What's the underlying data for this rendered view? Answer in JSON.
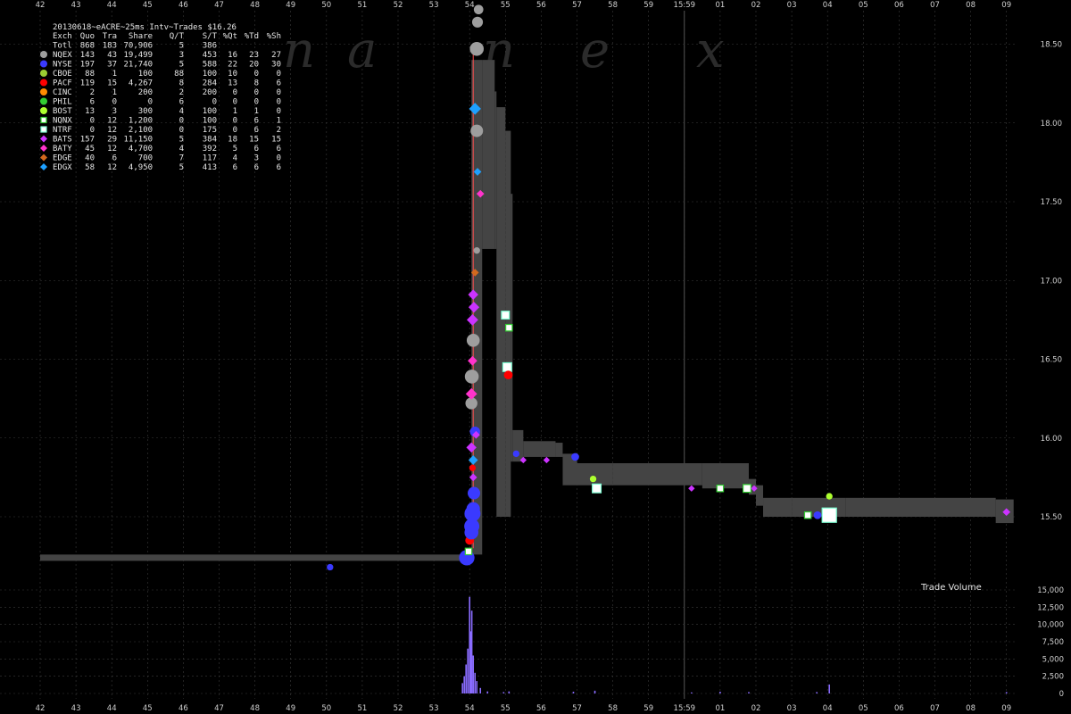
{
  "chart_data": {
    "type": "scatter",
    "title": "20130618~eACRE~25ms Intv~Trades $16.26",
    "watermark": [
      "n",
      "a",
      "n",
      "e",
      "x"
    ],
    "grid": true,
    "colors": {
      "background": "#000000",
      "grid": "#3a3a3a",
      "nbbo_band": "#444444",
      "text": "#e6e6e6"
    },
    "x_axis": {
      "tick_labels": [
        "42",
        "43",
        "44",
        "45",
        "46",
        "47",
        "48",
        "49",
        "50",
        "51",
        "52",
        "53",
        "54",
        "55",
        "56",
        "57",
        "58",
        "59",
        "15:59",
        "01",
        "02",
        "03",
        "04",
        "05",
        "06",
        "07",
        "08",
        "09"
      ]
    },
    "price_axis": {
      "ylim": [
        15.1,
        18.7
      ],
      "ticks": [
        15.5,
        16.0,
        16.5,
        17.0,
        17.5,
        18.0,
        18.5
      ],
      "tick_labels": [
        "15.50",
        "16.00",
        "16.50",
        "17.00",
        "17.50",
        "18.00",
        "18.50"
      ]
    },
    "volume_axis": {
      "title": "Trade Volume",
      "ylim": [
        0,
        15000
      ],
      "ticks": [
        0,
        2500,
        5000,
        7500,
        10000,
        12500,
        15000
      ],
      "tick_labels": [
        "0",
        "2,500",
        "5,000",
        "7,500",
        "10,000",
        "12,500",
        "15,000"
      ]
    },
    "legend": {
      "header": [
        "Exch",
        "Quo",
        "Tra",
        "Share",
        "Q/T",
        "S/T",
        "%Qt",
        "%Td",
        "%Sh"
      ],
      "rows": [
        {
          "exch": "Totl",
          "quo": "868",
          "tra": "183",
          "share": "70,906",
          "qt": "5",
          "st": "386",
          "pqt": "",
          "ptd": "",
          "psh": "",
          "color": "",
          "marker": "none"
        },
        {
          "exch": "NQEX",
          "quo": "143",
          "tra": "43",
          "share": "19,499",
          "qt": "3",
          "st": "453",
          "pqt": "16",
          "ptd": "23",
          "psh": "27",
          "color": "#9e9e9e",
          "marker": "circle"
        },
        {
          "exch": "NYSE",
          "quo": "197",
          "tra": "37",
          "share": "21,740",
          "qt": "5",
          "st": "588",
          "pqt": "22",
          "ptd": "20",
          "psh": "30",
          "color": "#3a3aff",
          "marker": "circle"
        },
        {
          "exch": "CBOE",
          "quo": "88",
          "tra": "1",
          "share": "100",
          "qt": "88",
          "st": "100",
          "pqt": "10",
          "ptd": "0",
          "psh": "0",
          "color": "#9acd32",
          "marker": "circle"
        },
        {
          "exch": "PACF",
          "quo": "119",
          "tra": "15",
          "share": "4,267",
          "qt": "8",
          "st": "284",
          "pqt": "13",
          "ptd": "8",
          "psh": "6",
          "color": "#ff0000",
          "marker": "circle"
        },
        {
          "exch": "CINC",
          "quo": "2",
          "tra": "1",
          "share": "200",
          "qt": "2",
          "st": "200",
          "pqt": "0",
          "ptd": "0",
          "psh": "0",
          "color": "#ff8c00",
          "marker": "circle"
        },
        {
          "exch": "PHIL",
          "quo": "6",
          "tra": "0",
          "share": "0",
          "qt": "6",
          "st": "0",
          "pqt": "0",
          "ptd": "0",
          "psh": "0",
          "color": "#32cd32",
          "marker": "circle"
        },
        {
          "exch": "BOST",
          "quo": "13",
          "tra": "3",
          "share": "300",
          "qt": "4",
          "st": "100",
          "pqt": "1",
          "ptd": "1",
          "psh": "0",
          "color": "#adff2f",
          "marker": "circle"
        },
        {
          "exch": "NQNX",
          "quo": "0",
          "tra": "12",
          "share": "1,200",
          "qt": "0",
          "st": "100",
          "pqt": "0",
          "ptd": "6",
          "psh": "1",
          "color": "#32cd32",
          "marker": "square"
        },
        {
          "exch": "NTRF",
          "quo": "0",
          "tra": "12",
          "share": "2,100",
          "qt": "0",
          "st": "175",
          "pqt": "0",
          "ptd": "6",
          "psh": "2",
          "color": "#7fffd4",
          "marker": "square"
        },
        {
          "exch": "BATS",
          "quo": "157",
          "tra": "29",
          "share": "11,150",
          "qt": "5",
          "st": "384",
          "pqt": "18",
          "ptd": "15",
          "psh": "15",
          "color": "#cc33ff",
          "marker": "diamond"
        },
        {
          "exch": "BATY",
          "quo": "45",
          "tra": "12",
          "share": "4,700",
          "qt": "4",
          "st": "392",
          "pqt": "5",
          "ptd": "6",
          "psh": "6",
          "color": "#ff33cc",
          "marker": "diamond"
        },
        {
          "exch": "EDGE",
          "quo": "40",
          "tra": "6",
          "share": "700",
          "qt": "7",
          "st": "117",
          "pqt": "4",
          "ptd": "3",
          "psh": "0",
          "color": "#d2691e",
          "marker": "diamond"
        },
        {
          "exch": "EDGX",
          "quo": "58",
          "tra": "12",
          "share": "4,950",
          "qt": "5",
          "st": "413",
          "pqt": "6",
          "ptd": "6",
          "psh": "6",
          "color": "#1ea0ff",
          "marker": "diamond"
        }
      ]
    },
    "nbbo_band": [
      {
        "t": 0.0,
        "bid": 15.22,
        "ask": 15.26
      },
      {
        "t": 12.0,
        "bid": 15.22,
        "ask": 15.26
      },
      {
        "t": 12.05,
        "bid": 15.26,
        "ask": 18.4
      },
      {
        "t": 12.35,
        "bid": 17.2,
        "ask": 18.4
      },
      {
        "t": 12.7,
        "bid": 17.2,
        "ask": 18.2
      },
      {
        "t": 12.75,
        "bid": 15.5,
        "ask": 18.1
      },
      {
        "t": 13.0,
        "bid": 15.5,
        "ask": 17.95
      },
      {
        "t": 13.15,
        "bid": 15.85,
        "ask": 17.55
      },
      {
        "t": 13.2,
        "bid": 15.85,
        "ask": 16.05
      },
      {
        "t": 13.5,
        "bid": 15.88,
        "ask": 15.98
      },
      {
        "t": 14.4,
        "bid": 15.88,
        "ask": 15.97
      },
      {
        "t": 14.6,
        "bid": 15.7,
        "ask": 15.9
      },
      {
        "t": 15.0,
        "bid": 15.7,
        "ask": 15.84
      },
      {
        "t": 16.0,
        "bid": 15.7,
        "ask": 15.84
      },
      {
        "t": 18.5,
        "bid": 15.68,
        "ask": 15.84
      },
      {
        "t": 19.8,
        "bid": 15.64,
        "ask": 15.74
      },
      {
        "t": 20.0,
        "bid": 15.57,
        "ask": 15.7
      },
      {
        "t": 20.2,
        "bid": 15.5,
        "ask": 15.62
      },
      {
        "t": 21.0,
        "bid": 15.5,
        "ask": 15.62
      },
      {
        "t": 22.5,
        "bid": 15.5,
        "ask": 15.62
      },
      {
        "t": 26.7,
        "bid": 15.46,
        "ask": 15.61
      },
      {
        "t": 27.2,
        "bid": 15.46,
        "ask": 15.58
      }
    ],
    "trades": [
      {
        "t": 8.1,
        "p": 15.18,
        "exch": "NYSE",
        "shares": 100
      },
      {
        "t": 11.92,
        "p": 15.24,
        "exch": "NYSE",
        "shares": 1600
      },
      {
        "t": 11.97,
        "p": 15.28,
        "exch": "NQNX",
        "shares": 100
      },
      {
        "t": 12.0,
        "p": 15.35,
        "exch": "PACF",
        "shares": 300
      },
      {
        "t": 12.02,
        "p": 15.38,
        "exch": "BATS",
        "shares": 100
      },
      {
        "t": 12.05,
        "p": 15.4,
        "exch": "NYSE",
        "shares": 1200
      },
      {
        "t": 12.06,
        "p": 15.44,
        "exch": "NYSE",
        "shares": 1500
      },
      {
        "t": 12.08,
        "p": 15.52,
        "exch": "NYSE",
        "shares": 1800
      },
      {
        "t": 12.1,
        "p": 15.55,
        "exch": "NYSE",
        "shares": 1100
      },
      {
        "t": 12.12,
        "p": 15.65,
        "exch": "NYSE",
        "shares": 900
      },
      {
        "t": 12.1,
        "p": 15.75,
        "exch": "BATS",
        "shares": 200
      },
      {
        "t": 12.08,
        "p": 15.81,
        "exch": "PACF",
        "shares": 100
      },
      {
        "t": 12.1,
        "p": 15.86,
        "exch": "EDGX",
        "shares": 400
      },
      {
        "t": 12.05,
        "p": 15.94,
        "exch": "BATS",
        "shares": 500
      },
      {
        "t": 12.15,
        "p": 16.04,
        "exch": "NYSE",
        "shares": 500
      },
      {
        "t": 12.18,
        "p": 16.02,
        "exch": "BATS",
        "shares": 200
      },
      {
        "t": 12.05,
        "p": 16.22,
        "exch": "NQEX",
        "shares": 800
      },
      {
        "t": 12.05,
        "p": 16.28,
        "exch": "BATY",
        "shares": 700
      },
      {
        "t": 12.06,
        "p": 16.39,
        "exch": "NQEX",
        "shares": 1200
      },
      {
        "t": 12.08,
        "p": 16.49,
        "exch": "BATY",
        "shares": 400
      },
      {
        "t": 12.1,
        "p": 16.62,
        "exch": "NQEX",
        "shares": 1000
      },
      {
        "t": 12.08,
        "p": 16.75,
        "exch": "BATS",
        "shares": 700
      },
      {
        "t": 12.12,
        "p": 16.83,
        "exch": "BATS",
        "shares": 600
      },
      {
        "t": 12.1,
        "p": 16.91,
        "exch": "BATS",
        "shares": 500
      },
      {
        "t": 12.15,
        "p": 17.05,
        "exch": "EDGE",
        "shares": 200
      },
      {
        "t": 12.2,
        "p": 17.19,
        "exch": "NQEX",
        "shares": 100
      },
      {
        "t": 12.22,
        "p": 17.69,
        "exch": "EDGX",
        "shares": 200
      },
      {
        "t": 12.2,
        "p": 17.95,
        "exch": "NQEX",
        "shares": 900
      },
      {
        "t": 12.15,
        "p": 18.09,
        "exch": "EDGX",
        "shares": 800
      },
      {
        "t": 12.2,
        "p": 18.47,
        "exch": "NQEX",
        "shares": 1200
      },
      {
        "t": 12.22,
        "p": 18.64,
        "exch": "NQEX",
        "shares": 600
      },
      {
        "t": 12.25,
        "p": 18.72,
        "exch": "NQEX",
        "shares": 400
      },
      {
        "t": 12.3,
        "p": 17.55,
        "exch": "BATY",
        "shares": 200
      },
      {
        "t": 13.0,
        "p": 16.78,
        "exch": "NTRF",
        "shares": 200
      },
      {
        "t": 13.1,
        "p": 16.7,
        "exch": "NQNX",
        "shares": 100
      },
      {
        "t": 13.05,
        "p": 16.45,
        "exch": "NTRF",
        "shares": 300
      },
      {
        "t": 13.08,
        "p": 16.4,
        "exch": "PACF",
        "shares": 300
      },
      {
        "t": 13.3,
        "p": 15.9,
        "exch": "NYSE",
        "shares": 100
      },
      {
        "t": 13.5,
        "p": 15.86,
        "exch": "BATS",
        "shares": 100
      },
      {
        "t": 14.15,
        "p": 15.86,
        "exch": "BATS",
        "shares": 100
      },
      {
        "t": 14.95,
        "p": 15.88,
        "exch": "NYSE",
        "shares": 200
      },
      {
        "t": 15.45,
        "p": 15.74,
        "exch": "BOST",
        "shares": 100
      },
      {
        "t": 15.55,
        "p": 15.68,
        "exch": "NTRF",
        "shares": 300
      },
      {
        "t": 18.2,
        "p": 15.68,
        "exch": "BATS",
        "shares": 100
      },
      {
        "t": 19.0,
        "p": 15.68,
        "exch": "NQNX",
        "shares": 100
      },
      {
        "t": 19.75,
        "p": 15.68,
        "exch": "NQNX",
        "shares": 200
      },
      {
        "t": 19.95,
        "p": 15.68,
        "exch": "BATS",
        "shares": 100
      },
      {
        "t": 21.45,
        "p": 15.51,
        "exch": "NQNX",
        "shares": 100
      },
      {
        "t": 21.72,
        "p": 15.51,
        "exch": "NYSE",
        "shares": 200
      },
      {
        "t": 22.05,
        "p": 15.63,
        "exch": "BOST",
        "shares": 100
      },
      {
        "t": 22.05,
        "p": 15.51,
        "exch": "NTRF",
        "shares": 1300
      },
      {
        "t": 27.0,
        "p": 15.53,
        "exch": "BATS",
        "shares": 200
      }
    ],
    "volume_bars": [
      {
        "t": 11.8,
        "v": 1500
      },
      {
        "t": 11.85,
        "v": 2500
      },
      {
        "t": 11.9,
        "v": 4200
      },
      {
        "t": 11.95,
        "v": 6500
      },
      {
        "t": 12.0,
        "v": 14000
      },
      {
        "t": 12.03,
        "v": 9000
      },
      {
        "t": 12.06,
        "v": 12000
      },
      {
        "t": 12.1,
        "v": 5500
      },
      {
        "t": 12.15,
        "v": 3000
      },
      {
        "t": 12.2,
        "v": 1800
      },
      {
        "t": 12.3,
        "v": 800
      },
      {
        "t": 12.5,
        "v": 300
      },
      {
        "t": 12.95,
        "v": 200
      },
      {
        "t": 13.1,
        "v": 300
      },
      {
        "t": 14.9,
        "v": 250
      },
      {
        "t": 15.5,
        "v": 400
      },
      {
        "t": 18.2,
        "v": 150
      },
      {
        "t": 19.0,
        "v": 250
      },
      {
        "t": 19.8,
        "v": 200
      },
      {
        "t": 21.7,
        "v": 200
      },
      {
        "t": 22.05,
        "v": 1300
      },
      {
        "t": 27.0,
        "v": 200
      }
    ]
  }
}
